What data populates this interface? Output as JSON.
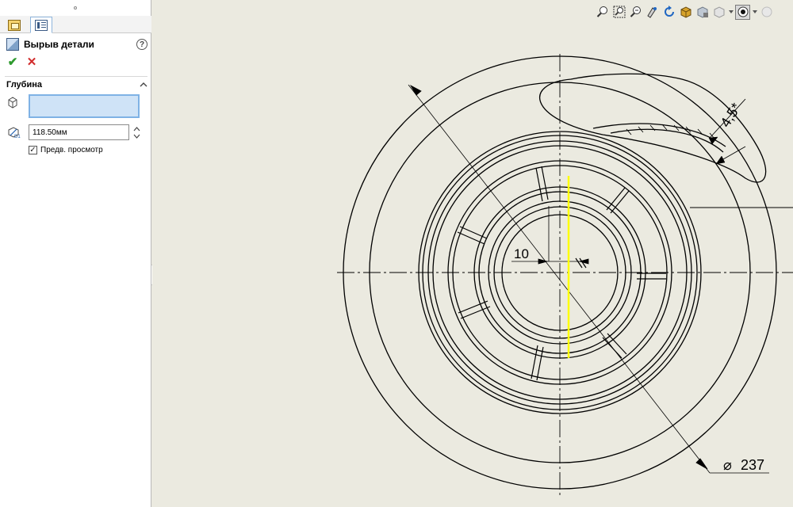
{
  "feature": {
    "title": "Вырыв детали",
    "help_symbol": "?"
  },
  "actions": {
    "ok_symbol": "✔",
    "cancel_symbol": "✕"
  },
  "depth_group": {
    "title": "Глубина",
    "depth_value": "118.50мм",
    "preview_label": "Предв. просмотр",
    "preview_checked": true
  },
  "drawing": {
    "dim_radial": "10",
    "dim_chamfer": "4,5*",
    "dim_diameter": "237",
    "diameter_symbol": "⌀"
  },
  "toolbar": {
    "icons": [
      "zoom-to-fit-icon",
      "zoom-to-area-icon",
      "zoom-in-out-icon",
      "pan-icon",
      "rotate-icon",
      "display-style-icon",
      "hide-show-icon",
      "view-orientation-icon",
      "apply-scene-icon"
    ]
  },
  "colors": {
    "viewport_background": "#ebeae0",
    "selection_highlight": "#ffff00",
    "selection_box": "#cfe3f7",
    "ok_green": "#2e9a2e",
    "cancel_red": "#d12b2b"
  }
}
